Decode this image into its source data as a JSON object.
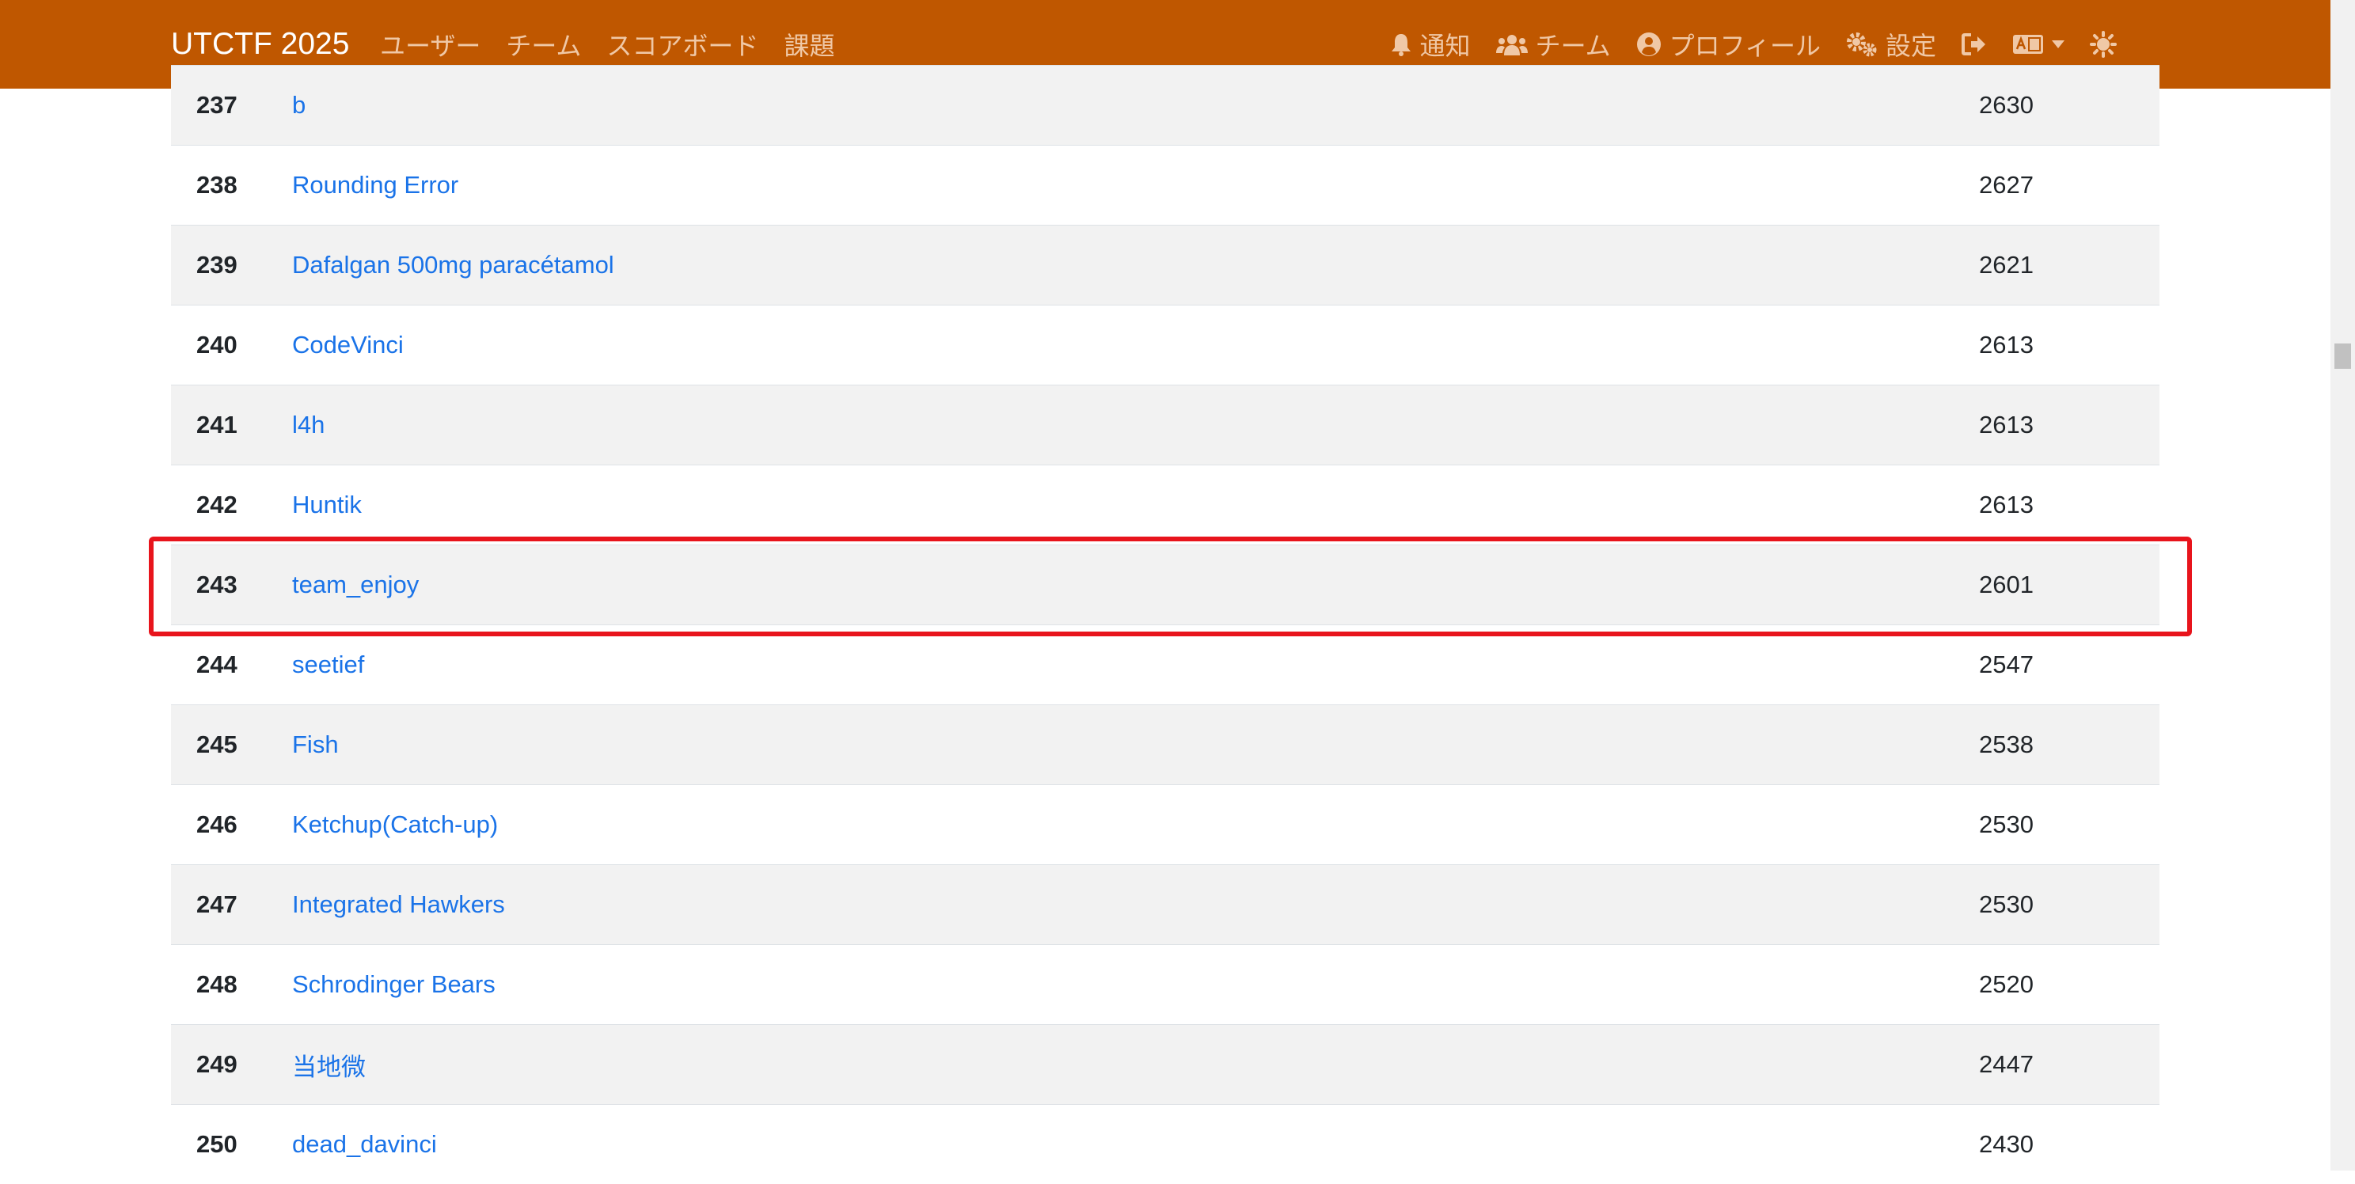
{
  "navbar": {
    "brand": "UTCTF 2025",
    "left_links": [
      "ユーザー",
      "チーム",
      "スコアボード",
      "課題"
    ],
    "notifications": "通知",
    "team": "チーム",
    "profile": "プロフィール",
    "settings": "設定",
    "colors": {
      "background": "#bf5700",
      "link": "#f0c8a6"
    }
  },
  "scoreboard": {
    "rows": [
      {
        "rank": "237",
        "team": "b",
        "score": "2630"
      },
      {
        "rank": "238",
        "team": "Rounding Error",
        "score": "2627"
      },
      {
        "rank": "239",
        "team": "Dafalgan 500mg paracétamol",
        "score": "2621"
      },
      {
        "rank": "240",
        "team": "CodeVinci",
        "score": "2613"
      },
      {
        "rank": "241",
        "team": "l4h",
        "score": "2613"
      },
      {
        "rank": "242",
        "team": "Huntik",
        "score": "2613"
      },
      {
        "rank": "243",
        "team": "team_enjoy",
        "score": "2601",
        "highlighted": true
      },
      {
        "rank": "244",
        "team": "seetief",
        "score": "2547"
      },
      {
        "rank": "245",
        "team": "Fish",
        "score": "2538"
      },
      {
        "rank": "246",
        "team": "Ketchup(Catch-up)",
        "score": "2530"
      },
      {
        "rank": "247",
        "team": "Integrated Hawkers",
        "score": "2530"
      },
      {
        "rank": "248",
        "team": "Schrodinger Bears",
        "score": "2520"
      },
      {
        "rank": "249",
        "team": "当地微",
        "score": "2447"
      },
      {
        "rank": "250",
        "team": "dead_davinci",
        "score": "2430"
      }
    ],
    "colors": {
      "link": "#1a73e8",
      "stripe": "#f2f2f2",
      "highlight": "#e8141c"
    }
  }
}
